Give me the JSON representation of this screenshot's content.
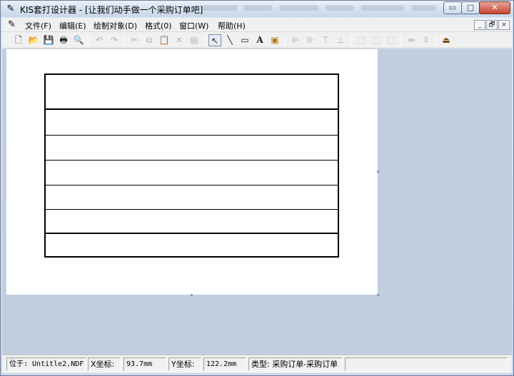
{
  "window": {
    "title": "KIS套打设计器 - [让我们动手做一个采购订单吧]",
    "caption_buttons": {
      "minimize": "▭",
      "maximize": "□",
      "close": "✕"
    }
  },
  "menu": {
    "items": [
      "文件(F)",
      "编辑(E)",
      "绘制对象(D)",
      "格式(0)",
      "窗口(W)",
      "帮助(H)"
    ],
    "mdi_buttons": {
      "minimize": "_",
      "restore": "🗗",
      "close": "×"
    }
  },
  "toolbar": {
    "icons": [
      {
        "name": "new-file-icon",
        "glyph": "🗋"
      },
      {
        "name": "open-folder-icon",
        "glyph": "📂"
      },
      {
        "name": "save-icon",
        "glyph": "💾"
      },
      {
        "name": "print-icon",
        "glyph": "🖶"
      },
      {
        "name": "print-preview-icon",
        "glyph": "🔍"
      },
      {
        "name": "undo-icon",
        "glyph": "↶"
      },
      {
        "name": "redo-icon",
        "glyph": "↷"
      },
      {
        "name": "cut-icon",
        "glyph": "✂"
      },
      {
        "name": "copy-icon",
        "glyph": "⧉"
      },
      {
        "name": "paste-icon",
        "glyph": "📋"
      },
      {
        "name": "delete-icon",
        "glyph": "✕"
      },
      {
        "name": "properties-icon",
        "glyph": "▤"
      },
      {
        "name": "select-pointer-icon",
        "glyph": "↖"
      },
      {
        "name": "line-tool-icon",
        "glyph": "╲"
      },
      {
        "name": "rectangle-tool-icon",
        "glyph": "▭"
      },
      {
        "name": "text-tool-icon",
        "glyph": "A"
      },
      {
        "name": "image-tool-icon",
        "glyph": "▣"
      },
      {
        "name": "align-left-icon",
        "glyph": "⊫"
      },
      {
        "name": "align-right-icon",
        "glyph": "⊪"
      },
      {
        "name": "align-top-icon",
        "glyph": "⊤"
      },
      {
        "name": "align-bottom-icon",
        "glyph": "⊥"
      },
      {
        "name": "same-width-icon",
        "glyph": "⬚"
      },
      {
        "name": "same-height-icon",
        "glyph": "⬚"
      },
      {
        "name": "same-size-icon",
        "glyph": "⬚"
      },
      {
        "name": "horizontal-spacing-icon",
        "glyph": "⇹"
      },
      {
        "name": "vertical-spacing-icon",
        "glyph": "⇳"
      },
      {
        "name": "exit-icon",
        "glyph": "⏏"
      }
    ]
  },
  "statusbar": {
    "location": "位于: Untitle2.NDF",
    "x_label": "X坐标:",
    "x_value": "93.7mm",
    "y_label": "Y坐标:",
    "y_value": "122.2mm",
    "type": "类型: 采购订单-采购订单"
  }
}
